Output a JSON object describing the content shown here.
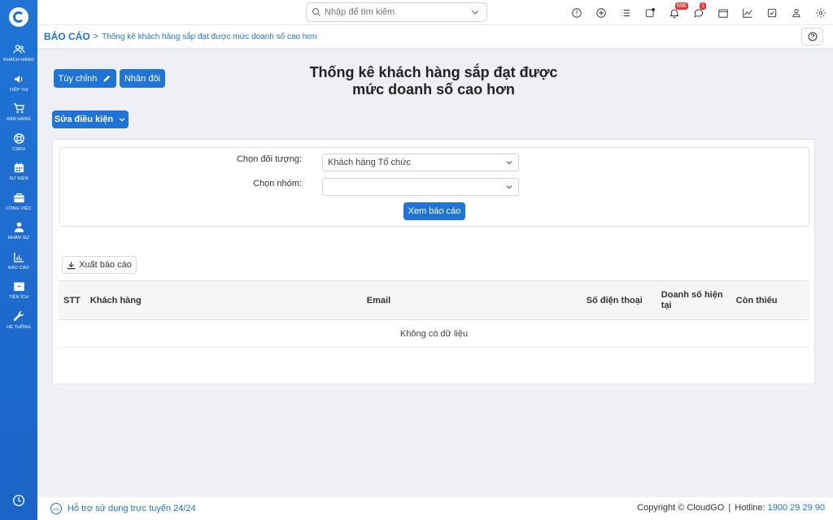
{
  "sidebar": {
    "items": [
      {
        "label": "KHÁCH HÀNG",
        "icon": "users-icon"
      },
      {
        "label": "TIẾP THỊ",
        "icon": "megaphone-icon"
      },
      {
        "label": "BÁN HÀNG",
        "icon": "cart-icon"
      },
      {
        "label": "CSKH",
        "icon": "lifebuoy-icon"
      },
      {
        "label": "SỰ KIỆN",
        "icon": "calendar-icon"
      },
      {
        "label": "CÔNG VIỆC",
        "icon": "briefcase-icon"
      },
      {
        "label": "NHÂN SỰ",
        "icon": "person-icon"
      },
      {
        "label": "BÁO CÁO",
        "icon": "chart-icon"
      },
      {
        "label": "TIỆN ÍCH",
        "icon": "box-icon"
      },
      {
        "label": "HỆ THỐNG",
        "icon": "wrench-icon"
      }
    ]
  },
  "topbar": {
    "search_placeholder": "Nhập để tìm kiếm",
    "notification_badge": "696",
    "chat_badge": "1"
  },
  "breadcrumb": {
    "root": "BÁO CÁO",
    "separator": ">",
    "page": "Thống kê khách hàng sắp đạt được mức doanh số cao hơn"
  },
  "actions": {
    "customize": "Tùy chỉnh",
    "duplicate": "Nhân đôi",
    "edit_conditions": "Sửa điều kiện"
  },
  "title_line1": "Thống kê khách hàng sắp đạt được",
  "title_line2": "mức doanh số cao hơn",
  "filters": {
    "target_label": "Chọn đối tượng:",
    "target_value": "Khách hàng Tổ chức",
    "group_label": "Chọn nhóm:",
    "group_value": "",
    "view_button": "Xem báo cáo"
  },
  "export_button": "Xuất báo cáo",
  "table": {
    "columns": [
      "STT",
      "Khách hàng",
      "Email",
      "Số điện thoại",
      "Doanh số hiện tại",
      "Còn thiếu"
    ],
    "empty_text": "Không có dữ liệu"
  },
  "footer": {
    "zalo": "Zalo",
    "support": "Hỗ trợ sử dụng trực tuyến 24/24",
    "copyright": "Copyright © CloudGO",
    "hotline_label": "Hotline:",
    "hotline_number": "1900 29 29 90"
  }
}
